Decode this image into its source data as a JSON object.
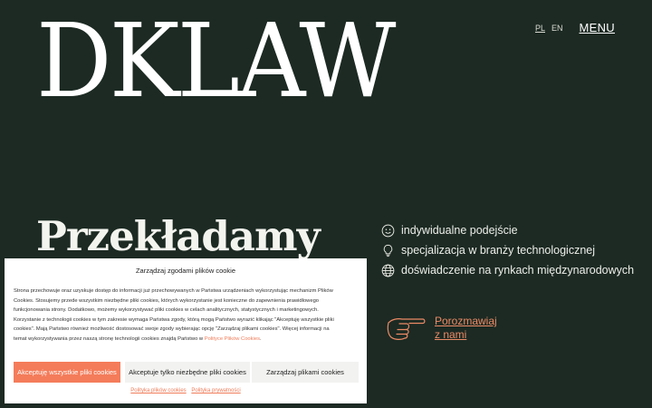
{
  "brand": {
    "logo_text": "DKLAW"
  },
  "nav": {
    "languages": [
      {
        "label": "PL",
        "active": true
      },
      {
        "label": "EN",
        "active": false
      }
    ],
    "menu_label": "MENU"
  },
  "hero": {
    "headline": "Przekładamy"
  },
  "features": [
    {
      "icon": "smile-icon",
      "text": "indywidualne podejście"
    },
    {
      "icon": "lightbulb-icon",
      "text": "specjalizacja w branży technologicznej"
    },
    {
      "icon": "globe-icon",
      "text": "doświadczenie na rynkach międzynarodowych"
    }
  ],
  "cta": {
    "icon": "pointing-hand-icon",
    "line1": "Porozmawiaj",
    "line2": "z nami"
  },
  "cookie": {
    "title": "Zarządzaj zgodami plików cookie",
    "body_before_link": "Strona przechowuje oraz uzyskuje dostęp do informacji już przechowywanych w Państwa urządzeniach wykorzystując mechanizm Plików Cookies. Stosujemy przede wszystkim niezbędne pliki cookies, których wykorzystanie jest konieczne do zapewnienia prawidłowego funkcjonowania strony. Dodatkowo, możemy wykorzystywać pliki cookies w celach analitycznych, statystycznych i marketingowych. Korzystanie z technologii cookies w tym zakresie wymaga Państwa zgody, którą mogą Państwo wyrazić klikając \"Akceptuję wszystkie pliki cookies\". Mają Państwo również możliwość dostosować swoje zgody wybierając opcję \"Zarządzaj plikami cookies\". Więcej informacji na temat wykorzystywania przez naszą stronę technologii cookies znajdą Państwo w",
    "body_link": "Polityce Plików Cookies",
    "body_after_link": ".",
    "buttons": {
      "accept_all": "Akceptuję wszystkie pliki cookies",
      "accept_needed": "Akceptuje tylko niezbędne pliki cookies",
      "manage": "Zarządzaj plikami cookies"
    },
    "links": {
      "cookies_policy": "Polityka plików cookies",
      "privacy_policy": "Polityka prywatności"
    }
  },
  "colors": {
    "background": "#1c2a23",
    "accent": "#f47c5a",
    "text": "#f1f1ec"
  }
}
